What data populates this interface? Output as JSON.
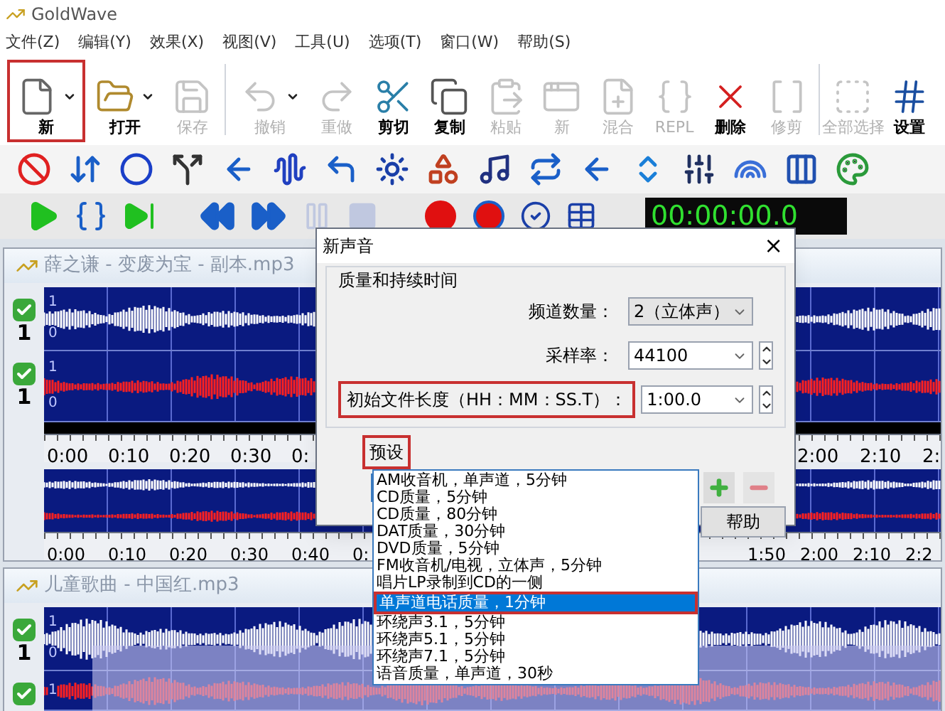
{
  "app_title": "GoldWave",
  "menu": [
    "文件(Z)",
    "编辑(Y)",
    "效果(X)",
    "视图(V)",
    "工具(U)",
    "选项(T)",
    "窗口(W)",
    "帮助(S)"
  ],
  "toolbar": [
    {
      "kind": "new",
      "label": "新",
      "disabled": false,
      "dropdown": true,
      "highlighted": true
    },
    {
      "kind": "open",
      "label": "打开",
      "disabled": false,
      "dropdown": true,
      "highlighted": false
    },
    {
      "kind": "save",
      "label": "保存",
      "disabled": true,
      "dropdown": false,
      "highlighted": false
    },
    {
      "kind": "undo",
      "label": "撤销",
      "disabled": true,
      "dropdown": true,
      "highlighted": false
    },
    {
      "kind": "redo",
      "label": "重做",
      "disabled": true,
      "dropdown": false,
      "highlighted": false
    },
    {
      "kind": "cut",
      "label": "剪切",
      "disabled": false,
      "dropdown": false,
      "highlighted": false
    },
    {
      "kind": "copy",
      "label": "复制",
      "disabled": false,
      "dropdown": false,
      "highlighted": false
    },
    {
      "kind": "paste",
      "label": "粘贴",
      "disabled": true,
      "dropdown": false,
      "highlighted": false
    },
    {
      "kind": "paste-new",
      "label": "新",
      "disabled": true,
      "dropdown": false,
      "highlighted": false
    },
    {
      "kind": "mix",
      "label": "混合",
      "disabled": true,
      "dropdown": false,
      "highlighted": false
    },
    {
      "kind": "replace",
      "label": "REPL",
      "disabled": true,
      "dropdown": false,
      "highlighted": false
    },
    {
      "kind": "delete",
      "label": "删除",
      "disabled": false,
      "dropdown": false,
      "highlighted": false
    },
    {
      "kind": "trim",
      "label": "修剪",
      "disabled": true,
      "dropdown": false,
      "highlighted": false
    },
    {
      "kind": "select-all",
      "label": "全部选择",
      "disabled": true,
      "dropdown": false,
      "highlighted": false
    },
    {
      "kind": "settings",
      "label": "设置",
      "disabled": false,
      "dropdown": false,
      "highlighted": false
    }
  ],
  "timer": "00:00:00.0",
  "documents": [
    {
      "title": "薛之谦 - 变废为宝 - 副本.mp3",
      "channels": [
        {
          "label": "1",
          "checked": true,
          "scale_labels": [
            "1",
            "0"
          ]
        },
        {
          "label": "1",
          "checked": true,
          "scale_labels": [
            "1",
            "0"
          ]
        }
      ],
      "ruler": {
        "left": [
          "0:00",
          "0:10",
          "0:20",
          "0:30",
          "0:"
        ],
        "right": [
          "2:00",
          "2:10",
          "2:"
        ]
      },
      "overview_ruler": {
        "left": [
          "0:00",
          "0:10",
          "0:20",
          "0:30",
          "0:40",
          "0:"
        ],
        "right": [
          "1:50",
          "2:00",
          "2:10",
          "2:2"
        ]
      }
    },
    {
      "title": "儿童歌曲 - 中国红.mp3",
      "channels": [
        {
          "label": "1",
          "checked": true,
          "scale_labels": [
            "1",
            "0"
          ]
        },
        {
          "checked": true,
          "scale_labels": [
            "1"
          ]
        }
      ]
    }
  ],
  "dialog": {
    "title": "新声音",
    "close": "×",
    "quality_group": {
      "title": "质量和持续时间",
      "fields": [
        {
          "kind": "select",
          "label": "频道数量：",
          "value": "2（立体声）",
          "highlighted": false
        },
        {
          "kind": "spin",
          "label": "采样率：",
          "value": "44100",
          "highlighted": false
        },
        {
          "kind": "spin",
          "label": "初始文件长度（HH：MM：SS.T）：",
          "value": "1:00.0",
          "highlighted": true
        }
      ]
    },
    "preset_group": {
      "title": "预设",
      "highlighted": true,
      "add_disabled": false,
      "remove_disabled": true
    },
    "help_button": "帮助",
    "preset_list": [
      {
        "label": "AM收音机，单声道，5分钟",
        "selected": false,
        "highlighted": false
      },
      {
        "label": "CD质量，5分钟",
        "selected": false,
        "highlighted": false
      },
      {
        "label": "CD质量，80分钟",
        "selected": false,
        "highlighted": false
      },
      {
        "label": "DAT质量，30分钟",
        "selected": false,
        "highlighted": false
      },
      {
        "label": "DVD质量，5分钟",
        "selected": false,
        "highlighted": false
      },
      {
        "label": "FM收音机/电视，立体声，5分钟",
        "selected": false,
        "highlighted": false
      },
      {
        "label": "唱片LP录制到CD的一侧",
        "selected": false,
        "highlighted": false
      },
      {
        "label": "单声道电话质量，1分钟",
        "selected": true,
        "highlighted": true
      },
      {
        "label": "环绕声3.1，5分钟",
        "selected": false,
        "highlighted": false
      },
      {
        "label": "环绕声5.1，5分钟",
        "selected": false,
        "highlighted": false
      },
      {
        "label": "环绕声7.1，5分钟",
        "selected": false,
        "highlighted": false
      },
      {
        "label": "语音质量，单声道，30秒",
        "selected": false,
        "highlighted": false
      }
    ]
  }
}
